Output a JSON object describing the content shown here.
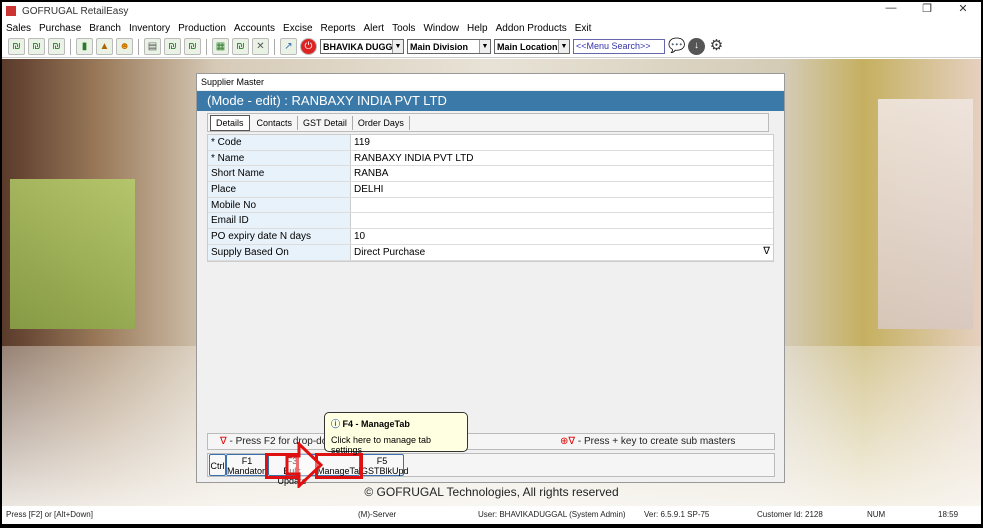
{
  "app": {
    "title": "GOFRUGAL RetailEasy",
    "window_controls": [
      "—",
      "❐",
      "✕"
    ]
  },
  "menu": [
    "Sales",
    "Purchase",
    "Branch",
    "Inventory",
    "Production",
    "Accounts",
    "Excise",
    "Reports",
    "Alert",
    "Tools",
    "Window",
    "Help",
    "Addon Products",
    "Exit"
  ],
  "toolbar": {
    "user": "BHAVIKA DUGG/",
    "division": "Main Division",
    "location": "Main Location",
    "search_placeholder": "<<Menu Search>>"
  },
  "dialog": {
    "title": "Supplier Master",
    "header": "(Mode - edit)  :  RANBAXY INDIA PVT LTD",
    "tabs": [
      "Details",
      "Contacts",
      "GST Detail",
      "Order Days"
    ],
    "fields": [
      {
        "label": "* Code",
        "value": "119"
      },
      {
        "label": "* Name",
        "value": "RANBAXY INDIA PVT LTD"
      },
      {
        "label": "Short Name",
        "value": "RANBA"
      },
      {
        "label": "Place",
        "value": "DELHI"
      },
      {
        "label": "Mobile No",
        "value": ""
      },
      {
        "label": "Email ID",
        "value": ""
      },
      {
        "label": "PO expiry date N days",
        "value": "10"
      },
      {
        "label": "Supply Based On",
        "value": "Direct Purchase"
      }
    ],
    "hint_left": "- Press F2 for drop-down or choose existing",
    "hint_right": "- Press + key to create sub masters",
    "fkeys": [
      {
        "key": "Ctrl",
        "label": ""
      },
      {
        "key": "F1",
        "label": "Mandatory"
      },
      {
        "key": "F3",
        "label": "Bulk Update"
      },
      {
        "key": "F4",
        "label": "ManageTab"
      },
      {
        "key": "F5",
        "label": "GSTBlkUpd"
      }
    ],
    "tooltip": {
      "title": "F4 - ManageTab",
      "text": "Click here to manage tab settings"
    }
  },
  "copyright": "© GOFRUGAL Technologies, All rights reserved",
  "status": {
    "hint": "Press [F2] or [Alt+Down]",
    "server": "(M)-Server",
    "user": "User: BHAVIKADUGGAL (System Admin)",
    "version": "Ver: 6.5.9.1 SP-75",
    "customer": "Customer Id: 2128",
    "num": "NUM",
    "time": "18:59"
  }
}
